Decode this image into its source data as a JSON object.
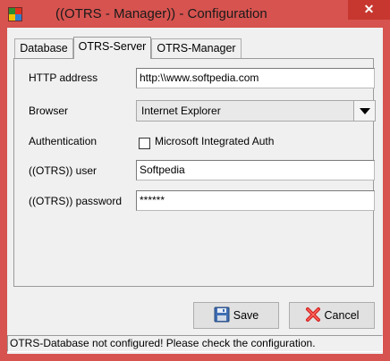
{
  "window": {
    "title": "((OTRS - Manager)) - Configuration",
    "close_glyph": "✕",
    "app_icon": "otrs-app-icon"
  },
  "tabs": [
    {
      "label": "Database",
      "active": false
    },
    {
      "label": "OTRS-Server",
      "active": true
    },
    {
      "label": "OTRS-Manager",
      "active": false
    }
  ],
  "form": {
    "http_address": {
      "label": "HTTP address",
      "value": "http:\\\\www.softpedia.com"
    },
    "browser": {
      "label": "Browser",
      "value": "Internet Explorer"
    },
    "authentication": {
      "label": "Authentication",
      "checkbox_label": "Microsoft Integrated Auth",
      "checked": false
    },
    "user": {
      "label": "((OTRS)) user",
      "value": "Softpedia"
    },
    "password": {
      "label": "((OTRS)) password",
      "value": "******"
    }
  },
  "buttons": {
    "save": {
      "label": "Save",
      "icon": "floppy-disk-icon"
    },
    "cancel": {
      "label": "Cancel",
      "icon": "red-x-icon"
    }
  },
  "status_bar": {
    "text": "OTRS-Database not configured! Please check the configuration."
  },
  "colors": {
    "titlebar": "#d6534f",
    "close_button": "#c7372f",
    "client_background": "#f0f0f0"
  }
}
